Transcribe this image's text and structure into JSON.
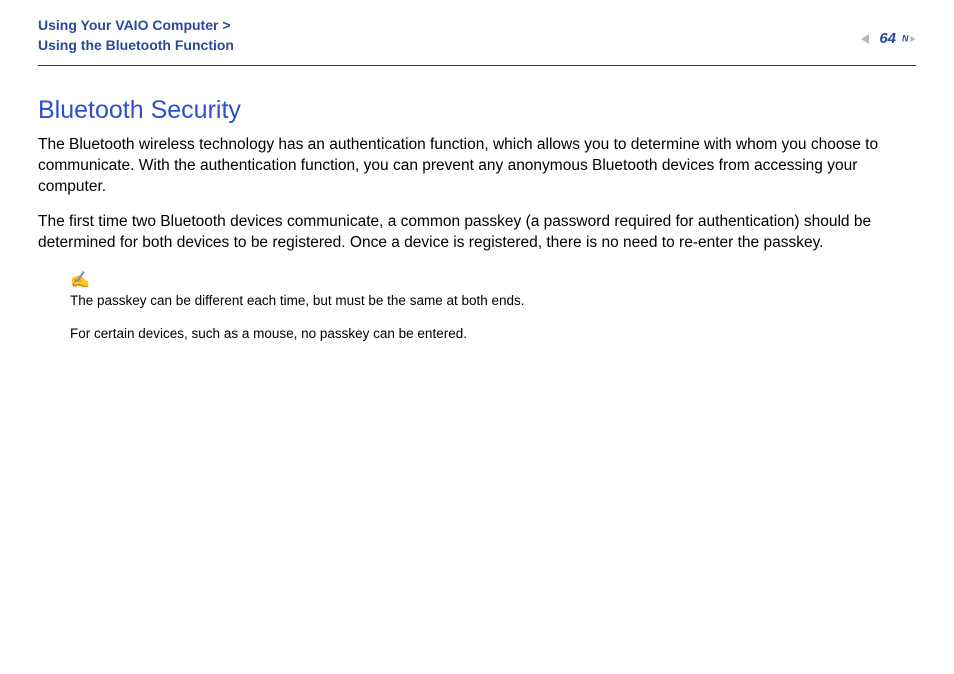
{
  "header": {
    "breadcrumb_line1": "Using Your VAIO Computer >",
    "breadcrumb_line2": "Using the Bluetooth Function",
    "page_number": "64",
    "nav_letter": "N"
  },
  "content": {
    "title": "Bluetooth Security",
    "paragraph1": "The Bluetooth wireless technology has an authentication function, which allows you to determine with whom you choose to communicate. With the authentication function, you can prevent any anonymous Bluetooth devices from accessing your computer.",
    "paragraph2": "The first time two Bluetooth devices communicate, a common passkey (a password required for authentication) should be determined for both devices to be registered. Once a device is registered, there is no need to re-enter the passkey."
  },
  "note": {
    "icon": "✍",
    "line1": "The passkey can be different each time, but must be the same at both ends.",
    "line2": "For certain devices, such as a mouse, no passkey can be entered."
  }
}
